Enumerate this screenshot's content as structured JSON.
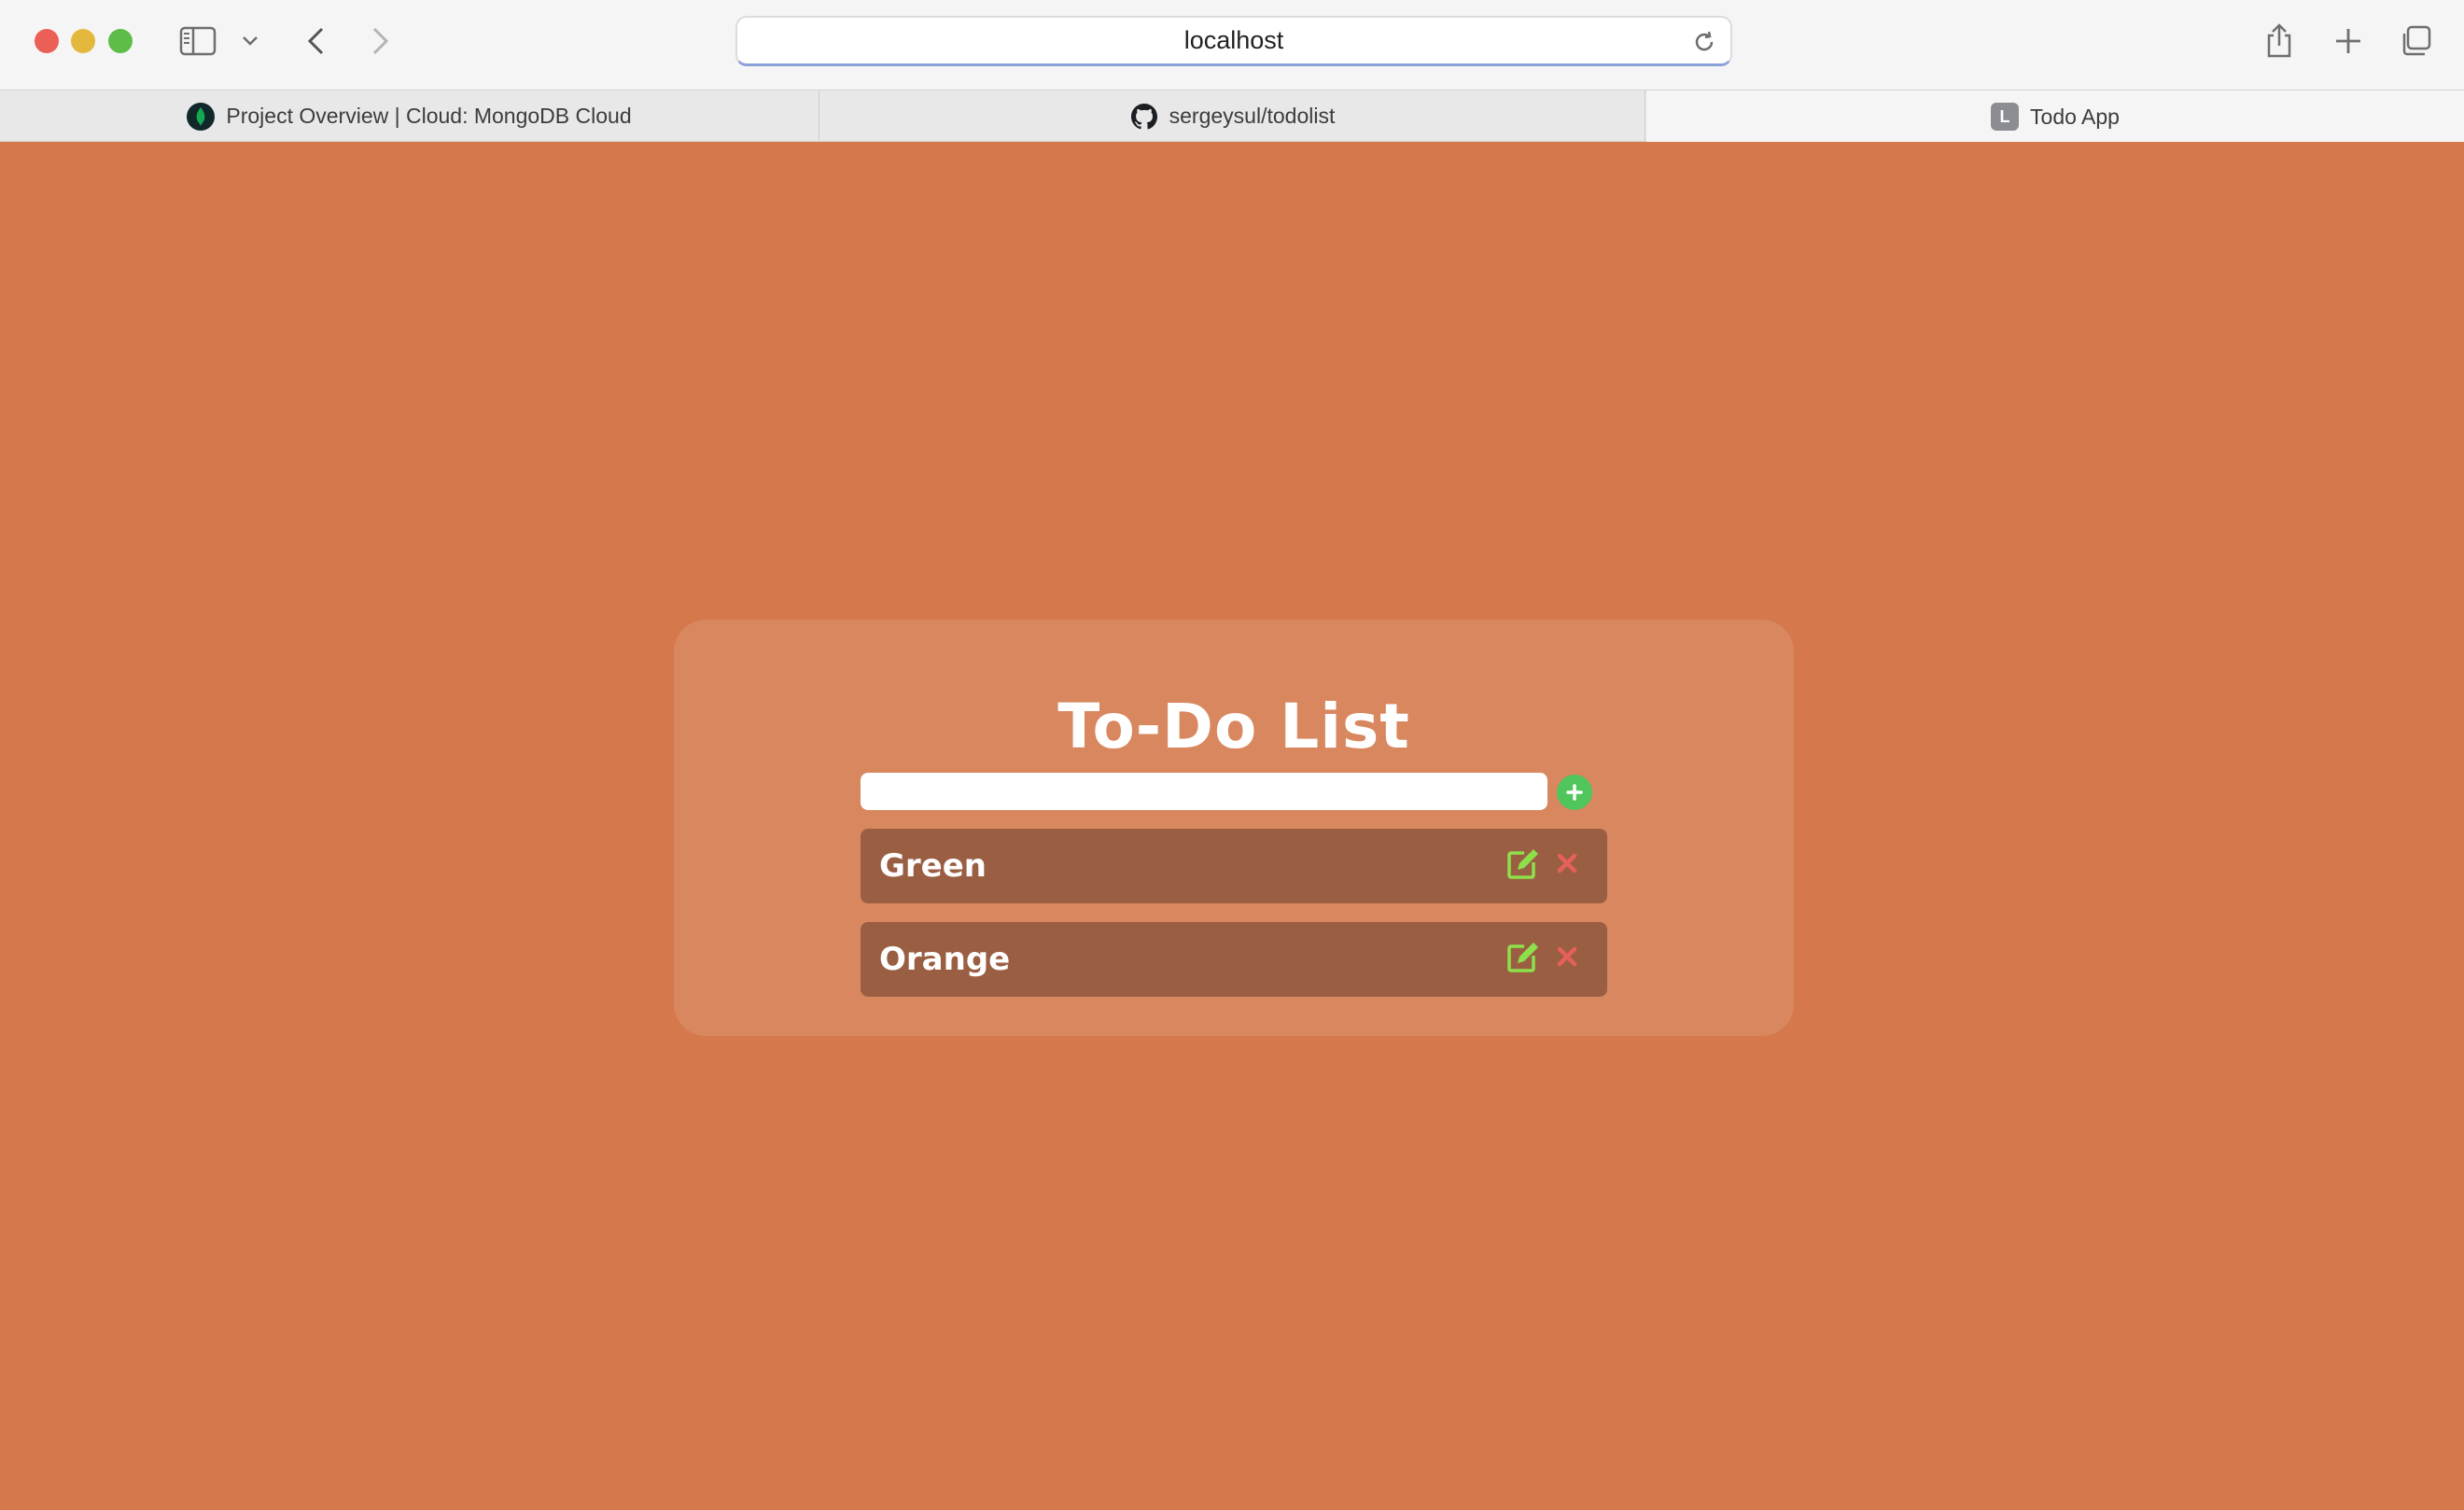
{
  "browser": {
    "url": "localhost",
    "tabs": [
      {
        "label": "Project Overview | Cloud: MongoDB Cloud",
        "icon": "mongodb-leaf-icon",
        "active": false
      },
      {
        "label": "sergeysul/todolist",
        "icon": "github-icon",
        "active": false
      },
      {
        "label": "Todo App",
        "icon": "letter-l-icon",
        "favicon_letter": "L",
        "active": true
      }
    ]
  },
  "app": {
    "title": "To-Do List",
    "input": {
      "value": "",
      "placeholder": ""
    },
    "add_icon": "plus-circle-icon",
    "todos": [
      {
        "text": "Green"
      },
      {
        "text": "Orange"
      }
    ]
  },
  "colors": {
    "page_background": "#d5784c",
    "card_background": "#d8875f",
    "item_background": "#9a5f43",
    "add_button": "#4fc55c",
    "edit_icon": "#8ee04a",
    "delete_icon": "#e5605a"
  }
}
